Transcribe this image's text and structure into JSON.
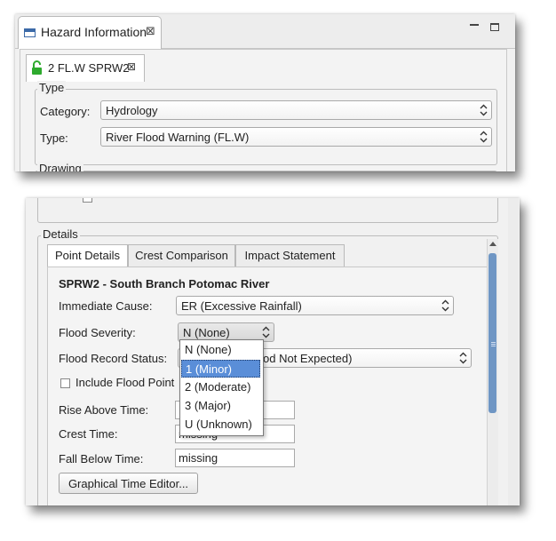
{
  "view_tab": {
    "title": "Hazard Information",
    "close_glyph": "⊠",
    "minimize_icon": "minimize-icon",
    "maximize_icon": "maximize-icon"
  },
  "editor_tab": {
    "label": "2 FL.W SPRW2",
    "close_glyph": "⊠",
    "lock_icon": "unlocked-lock-icon",
    "lock_color": "#2eaa2e"
  },
  "type_group": {
    "title": "Type",
    "category_label": "Category:",
    "category_value": "Hydrology",
    "type_label": "Type:",
    "type_value": "River Flood Warning (FL.W)"
  },
  "drawing_group": {
    "title": "Drawing"
  },
  "details": {
    "title": "Details",
    "tabs": [
      {
        "label": "Point Details",
        "active": true
      },
      {
        "label": "Crest Comparison",
        "active": false
      },
      {
        "label": "Impact Statement",
        "active": false
      }
    ],
    "point_title": "SPRW2 - South Branch Potomac River",
    "immediate_cause_label": "Immediate Cause:",
    "immediate_cause_value": "ER (Excessive Rainfall)",
    "flood_severity_label": "Flood Severity:",
    "flood_severity_value": "N (None)",
    "flood_record_label": "Flood Record Status:",
    "flood_record_value_visible": "od Not Expected)",
    "include_checkbox_label": "Include Flood Point",
    "rise_label": "Rise Above Time:",
    "crest_label": "Crest Time:",
    "crest_value_visible": "missing",
    "fall_label": "Fall Below Time:",
    "fall_value": "missing",
    "graphical_button": "Graphical Time Editor..."
  },
  "severity_dropdown": {
    "options": [
      "N (None)",
      "1 (Minor)",
      "2 (Moderate)",
      "3 (Major)",
      "U (Unknown)"
    ],
    "highlighted_index": 1
  },
  "colors": {
    "selection": "#5a8ed8",
    "scroll_thumb": "#6f96c4",
    "window_icon": "#3c6aa8"
  }
}
